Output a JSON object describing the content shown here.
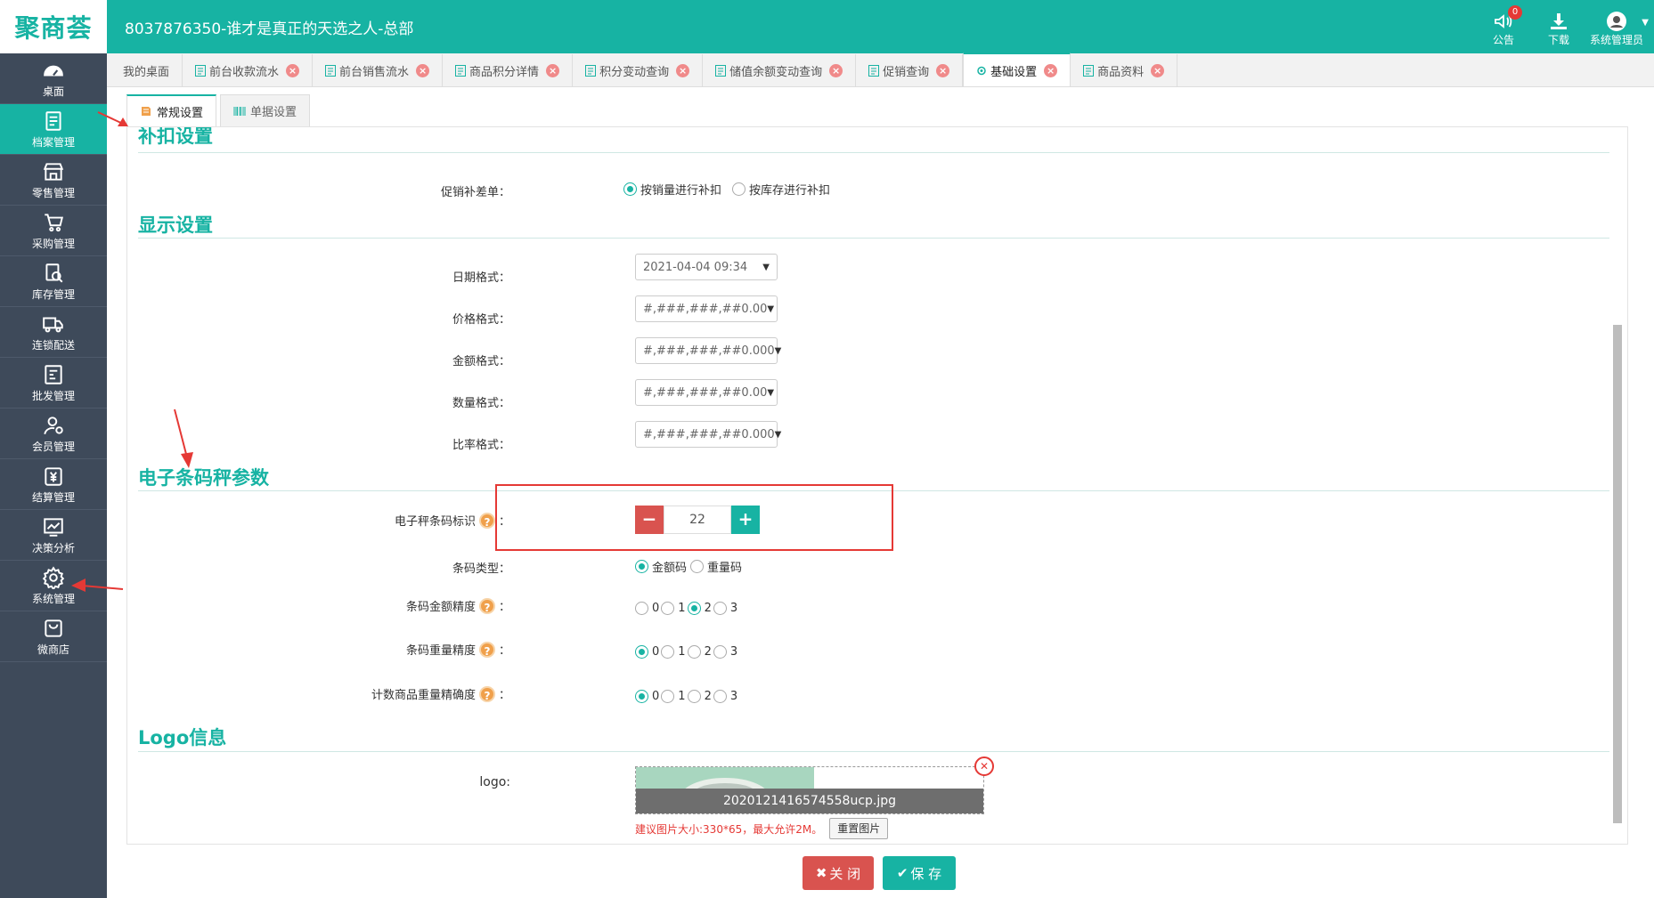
{
  "header": {
    "logo": "聚商荟",
    "title": "8037876350-谁才是真正的天选之人-总部",
    "actions": [
      {
        "label": "公告",
        "icon": "speaker-icon",
        "badge": "0"
      },
      {
        "label": "下载",
        "icon": "download-icon"
      },
      {
        "label": "系统管理员",
        "icon": "user-avatar-icon"
      }
    ]
  },
  "sidebar": {
    "items": [
      {
        "label": "桌面",
        "icon": "dashboard-icon"
      },
      {
        "label": "档案管理",
        "icon": "archive-icon",
        "active": true
      },
      {
        "label": "零售管理",
        "icon": "store-icon"
      },
      {
        "label": "采购管理",
        "icon": "cart-icon"
      },
      {
        "label": "库存管理",
        "icon": "inventory-icon"
      },
      {
        "label": "连锁配送",
        "icon": "truck-icon"
      },
      {
        "label": "批发管理",
        "icon": "wholesale-icon"
      },
      {
        "label": "会员管理",
        "icon": "member-icon"
      },
      {
        "label": "结算管理",
        "icon": "yen-icon"
      },
      {
        "label": "决策分析",
        "icon": "chart-icon"
      },
      {
        "label": "系统管理",
        "icon": "gear-icon"
      },
      {
        "label": "微商店",
        "icon": "shop-bag-icon"
      }
    ]
  },
  "tabs": [
    {
      "label": "我的桌面",
      "closable": false
    },
    {
      "label": "前台收款流水",
      "closable": true
    },
    {
      "label": "前台销售流水",
      "closable": true
    },
    {
      "label": "商品积分详情",
      "closable": true
    },
    {
      "label": "积分变动查询",
      "closable": true
    },
    {
      "label": "储值余额变动查询",
      "closable": true
    },
    {
      "label": "促销查询",
      "closable": true
    },
    {
      "label": "基础设置",
      "closable": true,
      "active": true
    },
    {
      "label": "商品资料",
      "closable": true
    }
  ],
  "subtabs": [
    {
      "label": "常规设置",
      "active": true
    },
    {
      "label": "单据设置"
    }
  ],
  "sections": {
    "deduction": {
      "title": "补扣设置",
      "promo_label": "促销补差单：",
      "options": [
        "按销量进行补扣",
        "按库存进行补扣"
      ],
      "selected": 0
    },
    "display": {
      "title": "显示设置",
      "fields": [
        {
          "label": "日期格式：",
          "value": "2021-04-04 09:34"
        },
        {
          "label": "价格格式：",
          "value": "#,###,###,##0.00"
        },
        {
          "label": "金额格式：",
          "value": "#,###,###,##0.000"
        },
        {
          "label": "数量格式：",
          "value": "#,###,###,##0.00"
        },
        {
          "label": "比率格式：",
          "value": "#,###,###,##0.000"
        }
      ]
    },
    "scale": {
      "title": "电子条码秤参数",
      "barcode_flag_label": "电子秤条码标识",
      "barcode_flag_value": "22",
      "barcode_type_label": "条码类型：",
      "barcode_type_options": [
        "金额码",
        "重量码"
      ],
      "barcode_type_selected": 0,
      "amount_precision_label": "条码金额精度",
      "amount_precision_selected": 2,
      "weight_precision_label": "条码重量精度",
      "weight_precision_selected": 0,
      "count_precision_label": "计数商品重量精确度",
      "count_precision_selected": 0,
      "precision_options": [
        "0",
        "1",
        "2",
        "3"
      ],
      "colon": "："
    },
    "logo": {
      "title": "Logo信息",
      "label": "logo:",
      "filename": "2020121416574558ucp.jpg",
      "hint": "建议图片大小:330*65，最大允许2M。",
      "reset_label": "重置图片"
    }
  },
  "footer": {
    "close_label": "关 闭",
    "save_label": "保 存"
  },
  "colors": {
    "accent": "#17b3a3",
    "sidebar": "#3e4a5a",
    "danger": "#d9534f",
    "annotation": "#e53935"
  }
}
